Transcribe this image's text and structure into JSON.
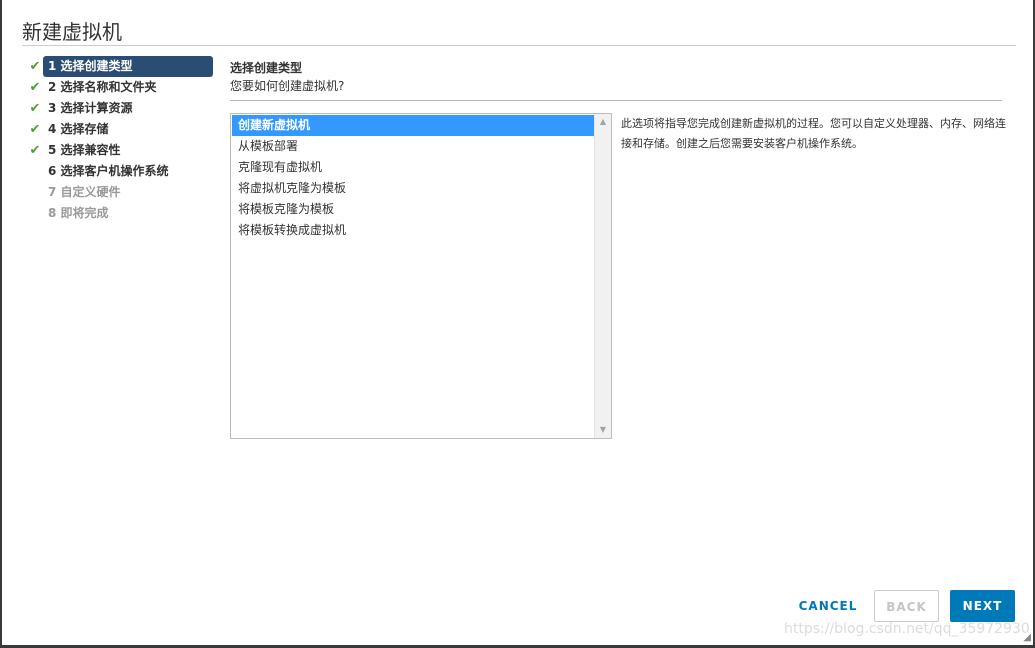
{
  "dialog": {
    "title": "新建虚拟机"
  },
  "steps": [
    {
      "label": "1 选择创建类型",
      "completed": true,
      "state": "active"
    },
    {
      "label": "2 选择名称和文件夹",
      "completed": true,
      "state": "normal"
    },
    {
      "label": "3 选择计算资源",
      "completed": true,
      "state": "normal"
    },
    {
      "label": "4 选择存储",
      "completed": true,
      "state": "normal"
    },
    {
      "label": "5 选择兼容性",
      "completed": true,
      "state": "normal"
    },
    {
      "label": "6 选择客户机操作系统",
      "completed": false,
      "state": "normal"
    },
    {
      "label": "7 自定义硬件",
      "completed": false,
      "state": "disabled"
    },
    {
      "label": "8 即将完成",
      "completed": false,
      "state": "disabled"
    }
  ],
  "content": {
    "title": "选择创建类型",
    "subtitle": "您要如何创建虚拟机?",
    "options": [
      "创建新虚拟机",
      "从模板部署",
      "克隆现有虚拟机",
      "将虚拟机克隆为模板",
      "将模板克隆为模板",
      "将模板转换成虚拟机"
    ],
    "selected_index": 0,
    "description": "此选项将指导您完成创建新虚拟机的过程。您可以自定义处理器、内存、网络连接和存储。创建之后您需要安装客户机操作系统。"
  },
  "buttons": {
    "cancel": "CANCEL",
    "back": "BACK",
    "next": "NEXT"
  },
  "watermark": "https://blog.csdn.net/qq_35972930",
  "icons": {
    "check": "check-icon",
    "scroll_up": "scroll-up-arrow-icon",
    "scroll_down": "scroll-down-arrow-icon",
    "resize": "resize-grip-icon"
  },
  "colors": {
    "active_step": "#2a4d74",
    "check": "#4c9f38",
    "selected_option": "#3399ff",
    "primary": "#0079b8"
  }
}
